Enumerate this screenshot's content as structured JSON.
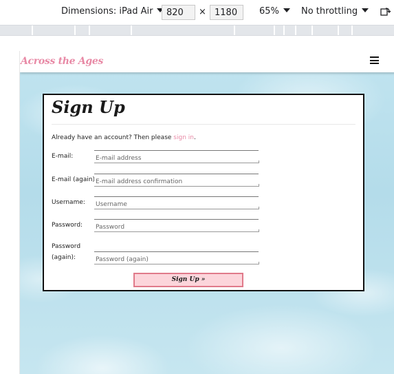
{
  "devtools": {
    "dimensions_label": "Dimensions: iPad Air",
    "width_value": "820",
    "times": "×",
    "height_value": "1180",
    "zoom": "65%",
    "throttling": "No throttling"
  },
  "nav": {
    "brand": "Across the Ages"
  },
  "form": {
    "title": "Sign Up",
    "lead_text": "Already have an account? Then please ",
    "signin_link": "sign in",
    "lead_end": ".",
    "fields": [
      {
        "label": "E-mail:",
        "placeholder": "E-mail address"
      },
      {
        "label": "E-mail (again):",
        "placeholder": "E-mail address confirmation"
      },
      {
        "label": "Username:",
        "placeholder": "Username"
      },
      {
        "label": "Password:",
        "placeholder": "Password"
      },
      {
        "label_line1": "Password",
        "label_line2": "(again):",
        "placeholder": "Password (again)"
      }
    ],
    "submit_label": "Sign Up »"
  },
  "colors": {
    "accent_pink": "#e88aa6",
    "button_bg": "#fcd5db",
    "button_border": "#e07a8a"
  }
}
